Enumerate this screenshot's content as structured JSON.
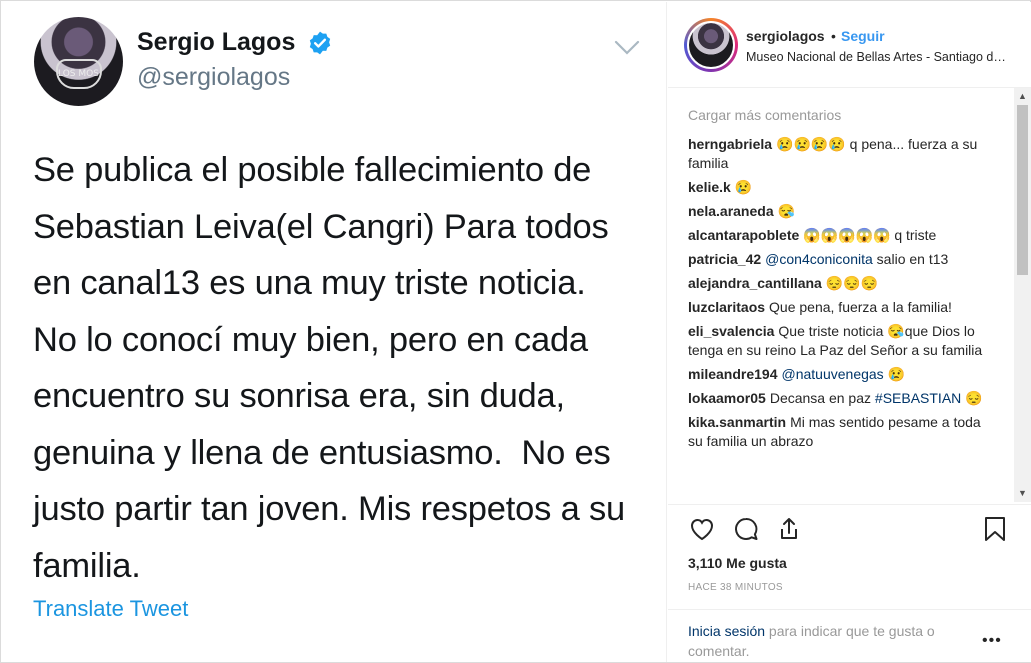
{
  "tweet": {
    "name": "Sergio Lagos",
    "handle": "@sergiolagos",
    "avatar_text": "LOS MOS",
    "lines": [
      "Se publica el posible fallecimiento de",
      "Sebastian Leiva(el Cangri) Para todos",
      "en canal13 es una muy triste noticia.",
      "No lo conocí muy bien, pero en cada",
      "encuentro su sonrisa era, sin duda,",
      "genuina y llena de entusiasmo.  No es",
      "justo partir tan joven. Mis respetos a su",
      "familia."
    ],
    "translate": "Translate Tweet",
    "colors": {
      "verified": "#1da1f2",
      "link": "#1b95e0"
    }
  },
  "post": {
    "username": "sergiolagos",
    "separator": "•",
    "follow": "Seguir",
    "location": "Museo Nacional de Bellas Artes - Santiago de Chile"
  },
  "comments": {
    "load_more": "Cargar más comentarios",
    "items": [
      {
        "user": "herngabriela",
        "text": "😢😢😢😢 q pena... fuerza a su familia"
      },
      {
        "user": "kelie.k",
        "text": "😢"
      },
      {
        "user": "nela.araneda",
        "text": "😪"
      },
      {
        "user": "alcantarapoblete",
        "text": "😱😱😱😱😱 q triste"
      },
      {
        "user": "patricia_42",
        "mention": "@con4coniconita",
        "text": " salio en t13"
      },
      {
        "user": "alejandra_cantillana",
        "text": "😔😔😔"
      },
      {
        "user": "luzclaritaos",
        "text": "Que pena, fuerza a la familia!"
      },
      {
        "user": "eli_svalencia",
        "text": "Que triste noticia 😪que Dios lo tenga en su reino La Paz del Señor a su familia"
      },
      {
        "user": "mileandre194",
        "mention": "@natuuvenegas",
        "text": " 😢"
      },
      {
        "user": "lokaamor05",
        "text": "Decansa en paz ",
        "tag": "#SEBASTIAN",
        "after": " 😔"
      },
      {
        "user": "kika.sanmartin",
        "text": "Mi mas sentido pesame a toda su familia un abrazo"
      }
    ]
  },
  "actions": {
    "icons": [
      "heart-icon",
      "comment-icon",
      "share-icon",
      "bookmark-icon"
    ],
    "likes": "3,110 Me gusta",
    "time": "HACE 38 MINUTOS",
    "login_link": "Inicia sesión",
    "login_text": " para indicar que te gusta o comentar.",
    "more": "•••"
  },
  "colors": {
    "instagram_blue": "#3897f0",
    "muted": "#999999",
    "text": "#262626"
  }
}
